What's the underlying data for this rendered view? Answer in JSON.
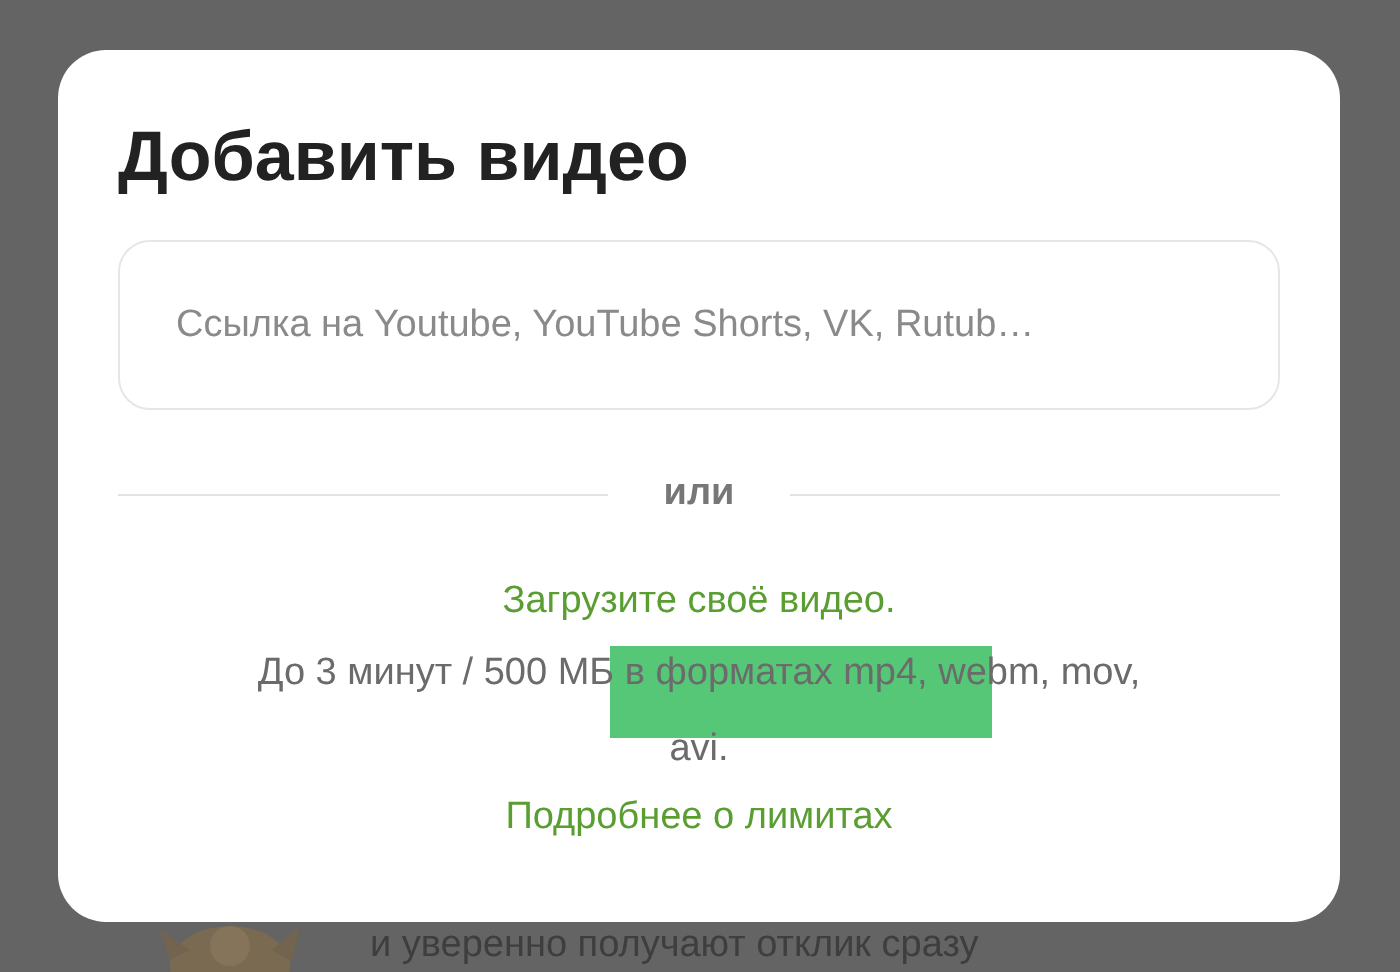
{
  "background_text": "и уверенно получают отклик сразу",
  "dialog": {
    "title": "Добавить видео",
    "link_field": {
      "placeholder": "Ссылка на Youtube, YouTube Shorts, VK, Rutub…"
    },
    "divider_label": "или",
    "upload_link": "Загрузите своё видео.",
    "limits_text": "До 3 минут / 500 МБ в форматах mp4, webm, mov, avi.",
    "limits_link": "Подробнее о лимитах"
  }
}
